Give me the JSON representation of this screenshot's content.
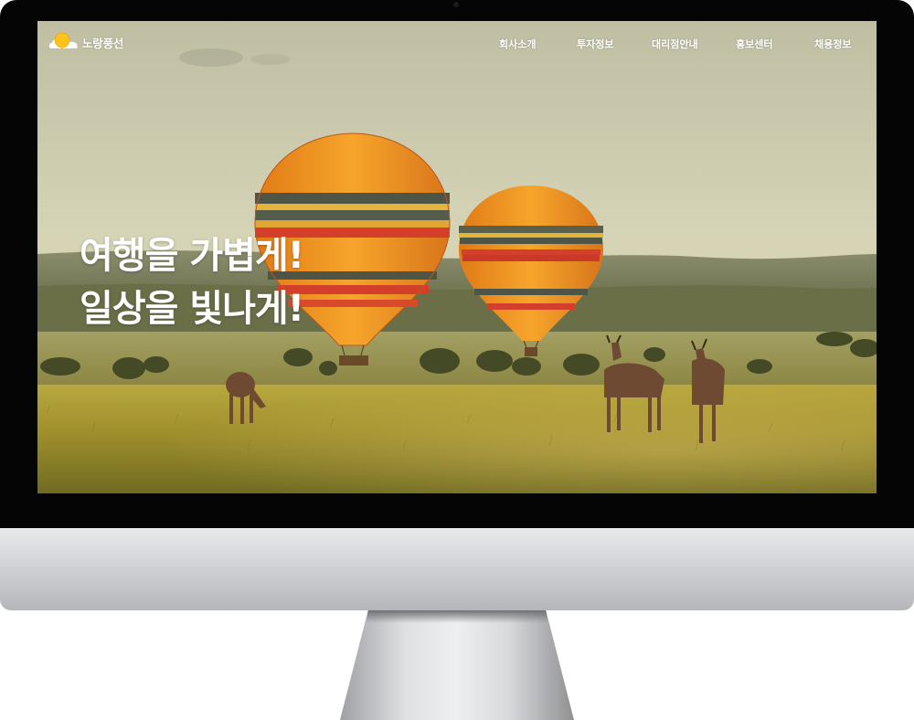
{
  "site": {
    "logo_text": "노랑풍선",
    "nav": [
      "회사소개",
      "투자정보",
      "대리점안내",
      "홍보센터",
      "채용정보"
    ]
  },
  "hero": {
    "line1": "여행을 가볍게!",
    "line2": "일상을 빛나게!"
  },
  "colors": {
    "bezel": "#050505",
    "brand_yellow": "#ffc21a",
    "balloon_orange": "#f08a1c",
    "balloon_red": "#d83a2a",
    "grass": "#b7a33a"
  },
  "icons": {
    "logo": "yellow-balloon-cloud-logo",
    "camera": "webcam-dot"
  }
}
